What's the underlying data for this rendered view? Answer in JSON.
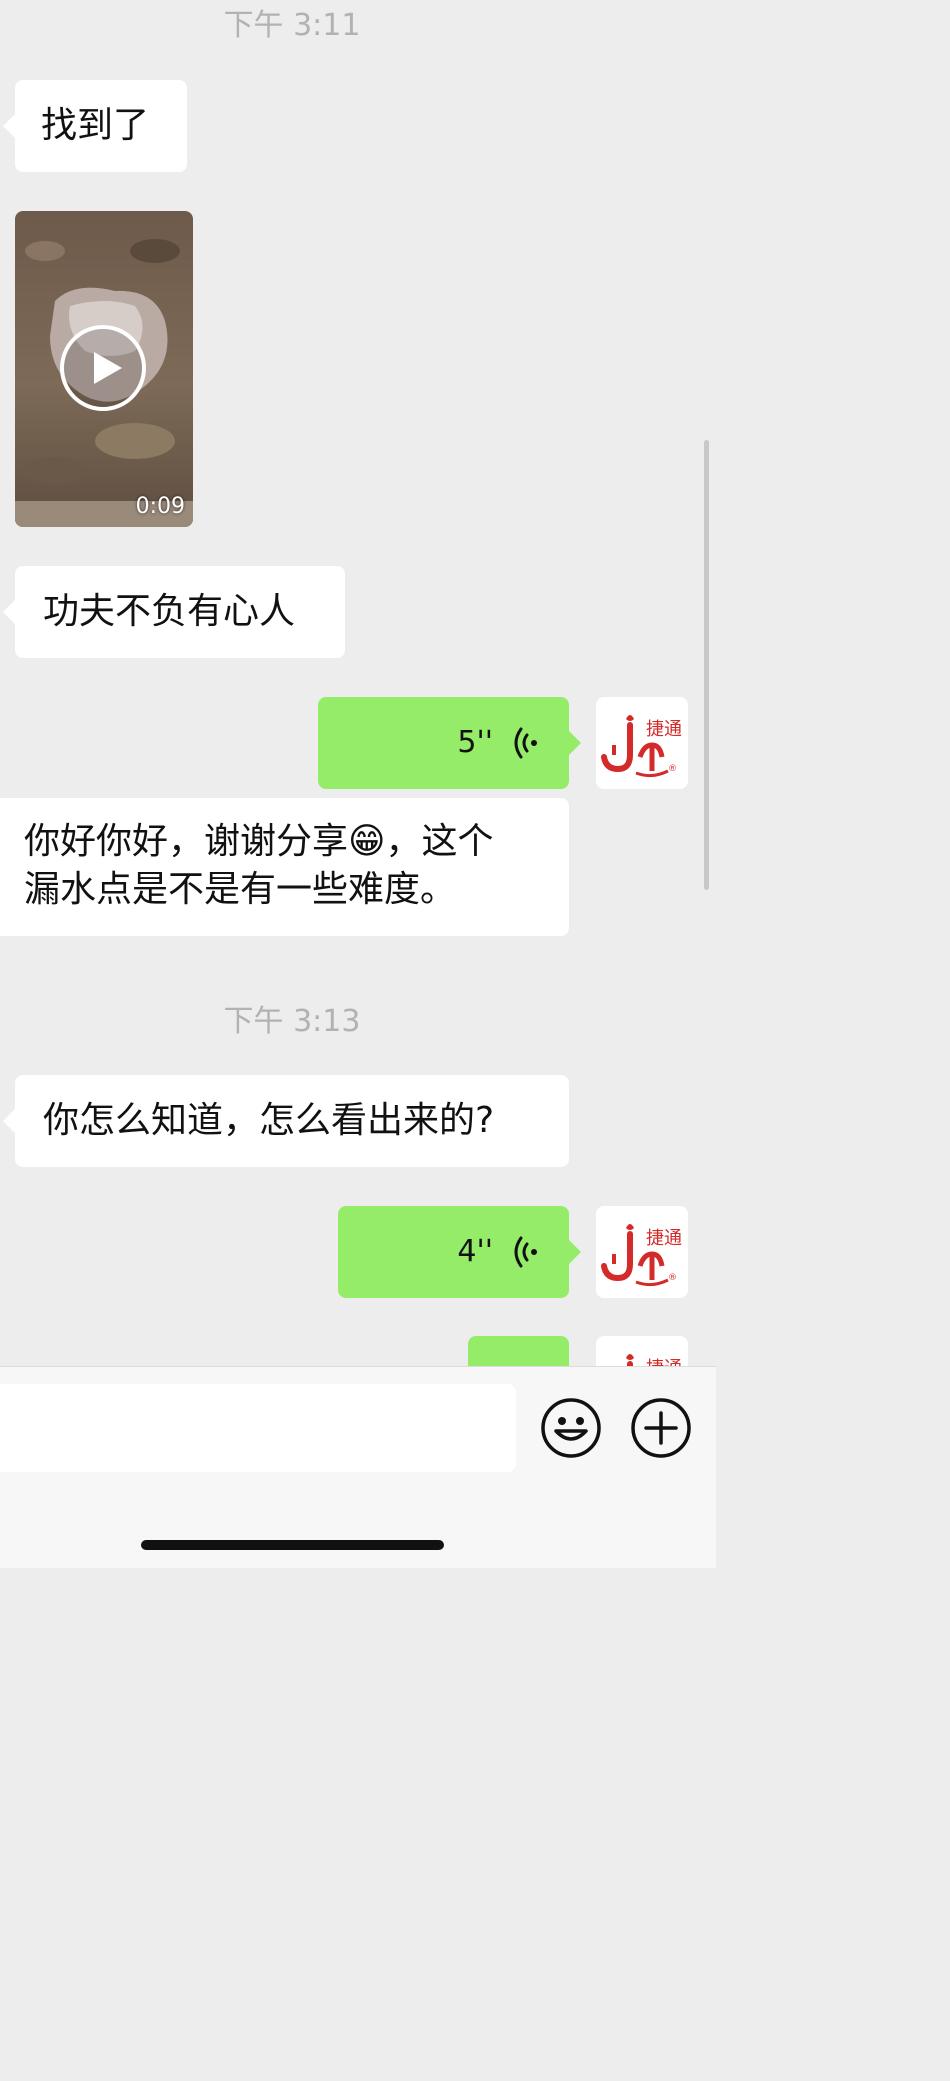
{
  "messages": [
    {
      "type": "timestamp",
      "text": "下午 3:11"
    },
    {
      "type": "text",
      "side": "left",
      "text": "找到了"
    },
    {
      "type": "video",
      "side": "left",
      "duration": "0:09"
    },
    {
      "type": "text",
      "side": "left",
      "text": "功夫不负有心人"
    },
    {
      "type": "voice",
      "side": "right",
      "duration": "5''"
    },
    {
      "type": "text",
      "side": "left",
      "line1": "你好你好，谢谢分享😁，这个",
      "line2": "漏水点是不是有一些难度。"
    },
    {
      "type": "timestamp",
      "text": "下午 3:13"
    },
    {
      "type": "text",
      "side": "left",
      "text": "你怎么知道，怎么看出来的?"
    },
    {
      "type": "voice",
      "side": "right",
      "duration": "4''"
    }
  ],
  "avatar": {
    "logo_text": "捷通",
    "mark": "®"
  },
  "input": {
    "value": "",
    "placeholder": ""
  },
  "icons": {
    "emoji_button": "emoji-face-icon",
    "more_button": "plus-circle-icon"
  },
  "colors": {
    "incoming_bubble": "#ffffff",
    "outgoing_bubble": "#95ec69",
    "background": "#ededed",
    "logo_red": "#d42a2a"
  }
}
